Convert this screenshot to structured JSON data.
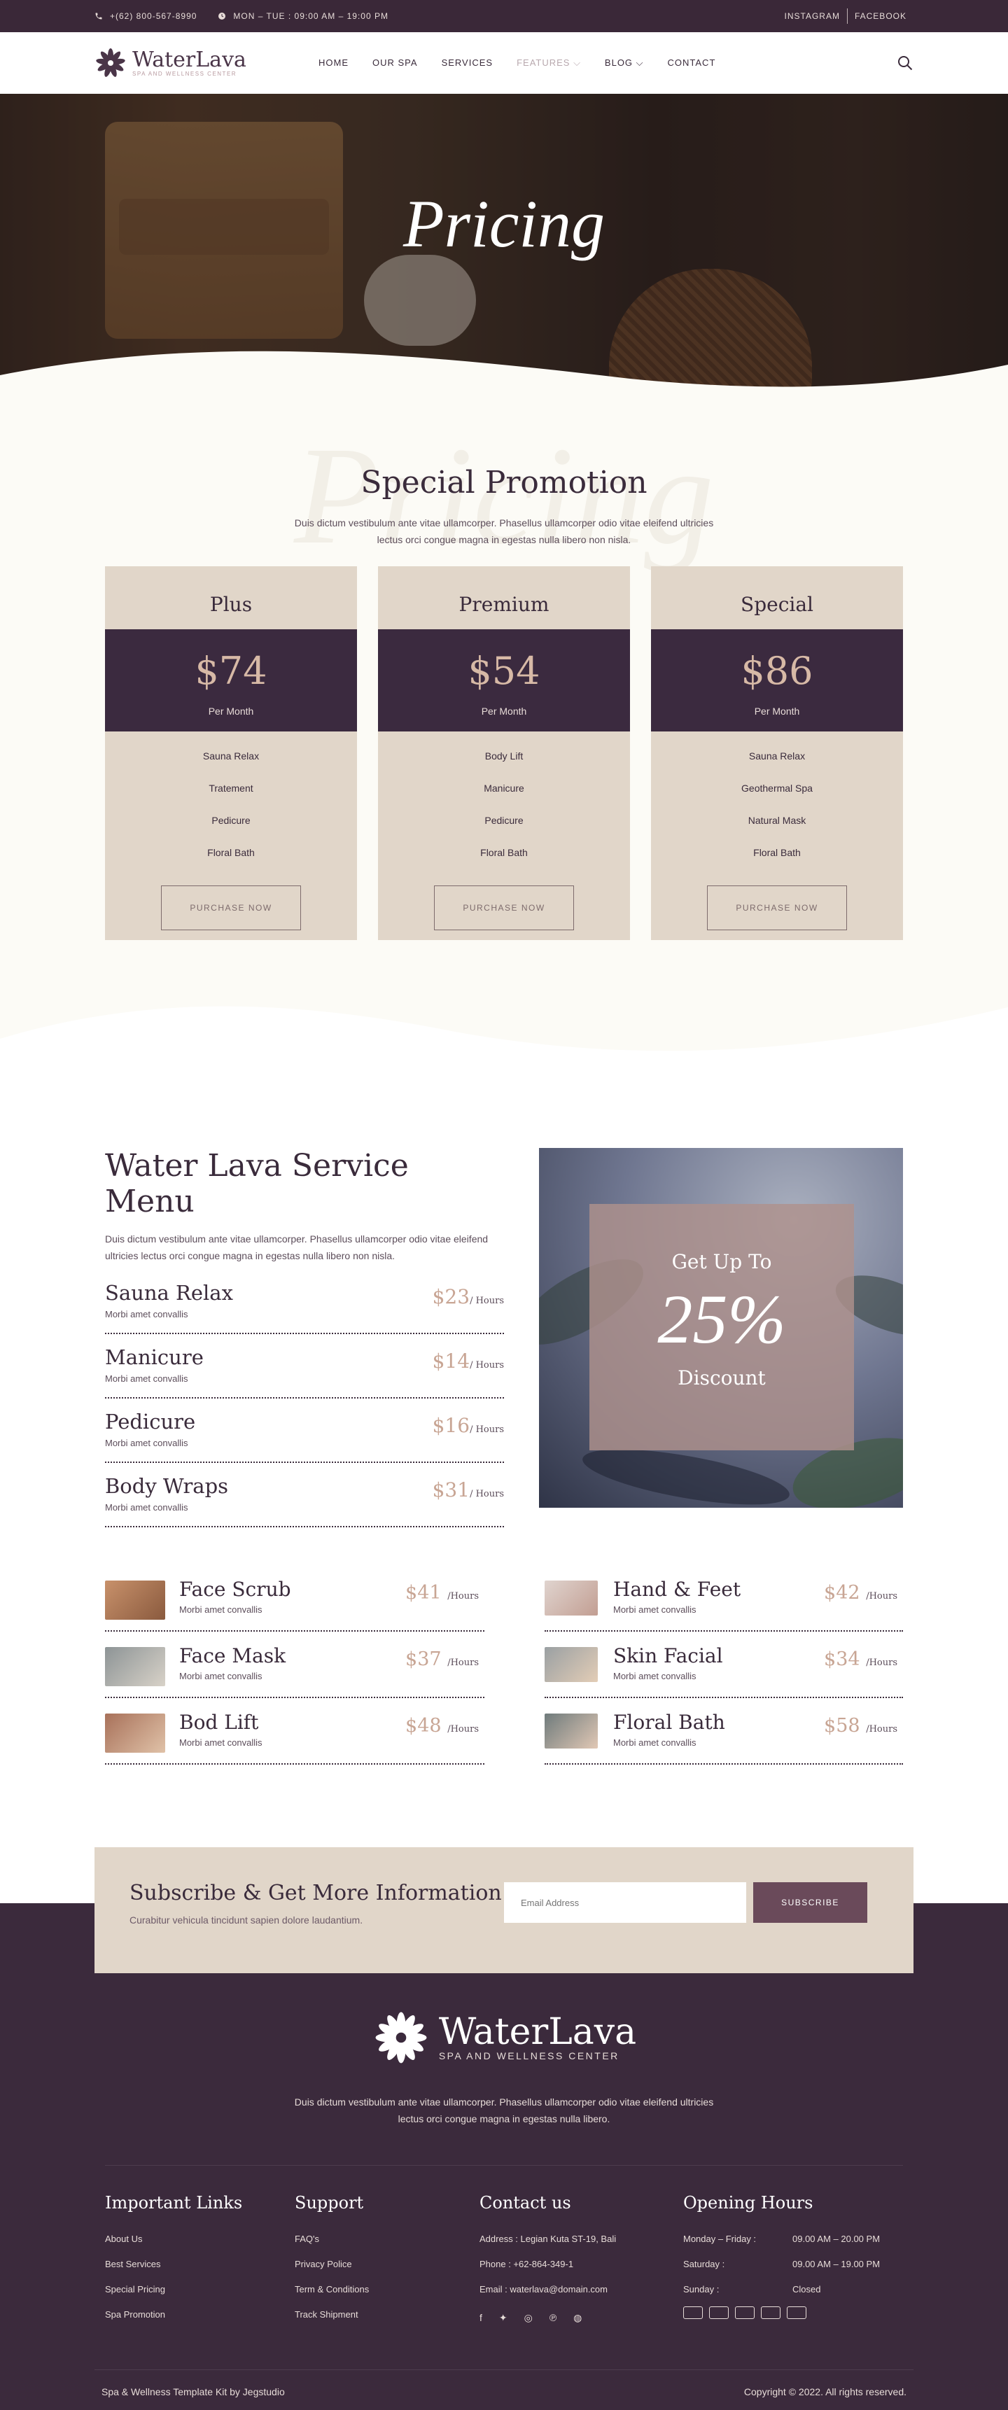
{
  "topbar": {
    "phone": "+(62) 800-567-8990",
    "hours": "MON – TUE : 09:00 AM – 19:00 PM",
    "links": [
      "INSTAGRAM",
      "FACEBOOK"
    ]
  },
  "nav": {
    "brand": "WaterLava",
    "tagline": "SPA AND WELLNESS CENTER",
    "items": [
      "HOME",
      "OUR SPA",
      "SERVICES",
      "FEATURES ⌵",
      "BLOG ⌵",
      "CONTACT"
    ],
    "active_index": 3
  },
  "hero": {
    "title": "Pricing"
  },
  "promotion": {
    "ghost": "Pricing",
    "title": "Special Promotion",
    "description": "Duis dictum vestibulum ante vitae ullamcorper. Phasellus ullamcorper odio vitae eleifend ultricies lectus orci congue magna in egestas nulla libero non nisla.",
    "plans": [
      {
        "name": "Plus",
        "price": "$74",
        "period": "Per Month",
        "features": [
          "Sauna Relax",
          "Tratement",
          "Pedicure",
          "Floral Bath"
        ],
        "cta": "PURCHASE NOW"
      },
      {
        "name": "Premium",
        "price": "$54",
        "period": "Per Month",
        "features": [
          "Body Lift",
          "Manicure",
          "Pedicure",
          "Floral Bath"
        ],
        "cta": "PURCHASE NOW"
      },
      {
        "name": "Special",
        "price": "$86",
        "period": "Per Month",
        "features": [
          "Sauna Relax",
          "Geothermal Spa",
          "Natural Mask",
          "Floral Bath"
        ],
        "cta": "PURCHASE NOW"
      }
    ]
  },
  "service_menu": {
    "title": "Water Lava Service Menu",
    "description": "Duis dictum vestibulum ante vitae ullamcorper. Phasellus ullamcorper odio vitae eleifend ultricies lectus orci congue magna in egestas nulla libero non nisla.",
    "unit": "/ Hours",
    "items": [
      {
        "name": "Sauna Relax",
        "sub": "Morbi amet convallis",
        "price": "$23"
      },
      {
        "name": "Manicure",
        "sub": "Morbi amet convallis",
        "price": "$14"
      },
      {
        "name": "Pedicure",
        "sub": "Morbi amet convallis",
        "price": "$16"
      },
      {
        "name": "Body Wraps",
        "sub": "Morbi amet convallis",
        "price": "$31"
      }
    ],
    "promo_box": {
      "top": "Get Up To",
      "percent": "25%",
      "bottom": "Discount"
    }
  },
  "extra_services": {
    "unit": "/Hours",
    "left": [
      {
        "name": "Face Scrub",
        "sub": "Morbi amet convallis",
        "price": "$41"
      },
      {
        "name": "Face Mask",
        "sub": "Morbi amet convallis",
        "price": "$37"
      },
      {
        "name": "Bod Lift",
        "sub": "Morbi amet convallis",
        "price": "$48"
      }
    ],
    "right": [
      {
        "name": "Hand & Feet",
        "sub": "Morbi amet convallis",
        "price": "$42"
      },
      {
        "name": "Skin Facial",
        "sub": "Morbi amet convallis",
        "price": "$34"
      },
      {
        "name": "Floral Bath",
        "sub": "Morbi amet convallis",
        "price": "$58"
      }
    ]
  },
  "subscribe": {
    "title": "Subscribe & Get More Information",
    "description": "Curabitur vehicula tincidunt sapien dolore laudantium.",
    "placeholder": "Email Address",
    "button": "SUBSCRIBE"
  },
  "footer": {
    "brand": "WaterLava",
    "tagline": "SPA AND WELLNESS CENTER",
    "description": "Duis dictum vestibulum ante vitae ullamcorper. Phasellus ullamcorper odio vitae eleifend ultricies lectus orci congue magna in egestas nulla libero.",
    "important_links": {
      "title": "Important Links",
      "items": [
        "About Us",
        "Best Services",
        "Special Pricing",
        "Spa Promotion"
      ]
    },
    "support": {
      "title": "Support",
      "items": [
        "FAQ's",
        "Privacy Police",
        "Term & Conditions",
        "Track Shipment"
      ]
    },
    "contact": {
      "title": "Contact us",
      "items": [
        "Address : Legian Kuta ST-19, Bali",
        "Phone : +62-864-349-1",
        "Email : waterlava@domain.com"
      ]
    },
    "hours": {
      "title": "Opening Hours",
      "rows": [
        {
          "day": "Monday – Friday :",
          "time": "09.00 AM – 20.00 PM"
        },
        {
          "day": "Saturday :",
          "time": "09.00 AM – 19.00 PM"
        },
        {
          "day": "Sunday :",
          "time": "Closed"
        }
      ]
    },
    "social_icons": [
      "facebook-icon",
      "twitter-icon",
      "instagram-icon",
      "pinterest-icon",
      "dribbble-icon"
    ],
    "payment_icons": [
      "mastercard-icon",
      "paypal-icon",
      "visa-icon",
      "card-icon",
      "amex-icon"
    ],
    "credit": "Spa & Wellness Template Kit by Jegstudio",
    "copyright": "Copyright © 2022. All rights reserved."
  },
  "colors": {
    "primary": "#3b2a3c",
    "accent": "#c8a594",
    "card": "#e1d6c9",
    "cream": "#fcfbf6"
  }
}
